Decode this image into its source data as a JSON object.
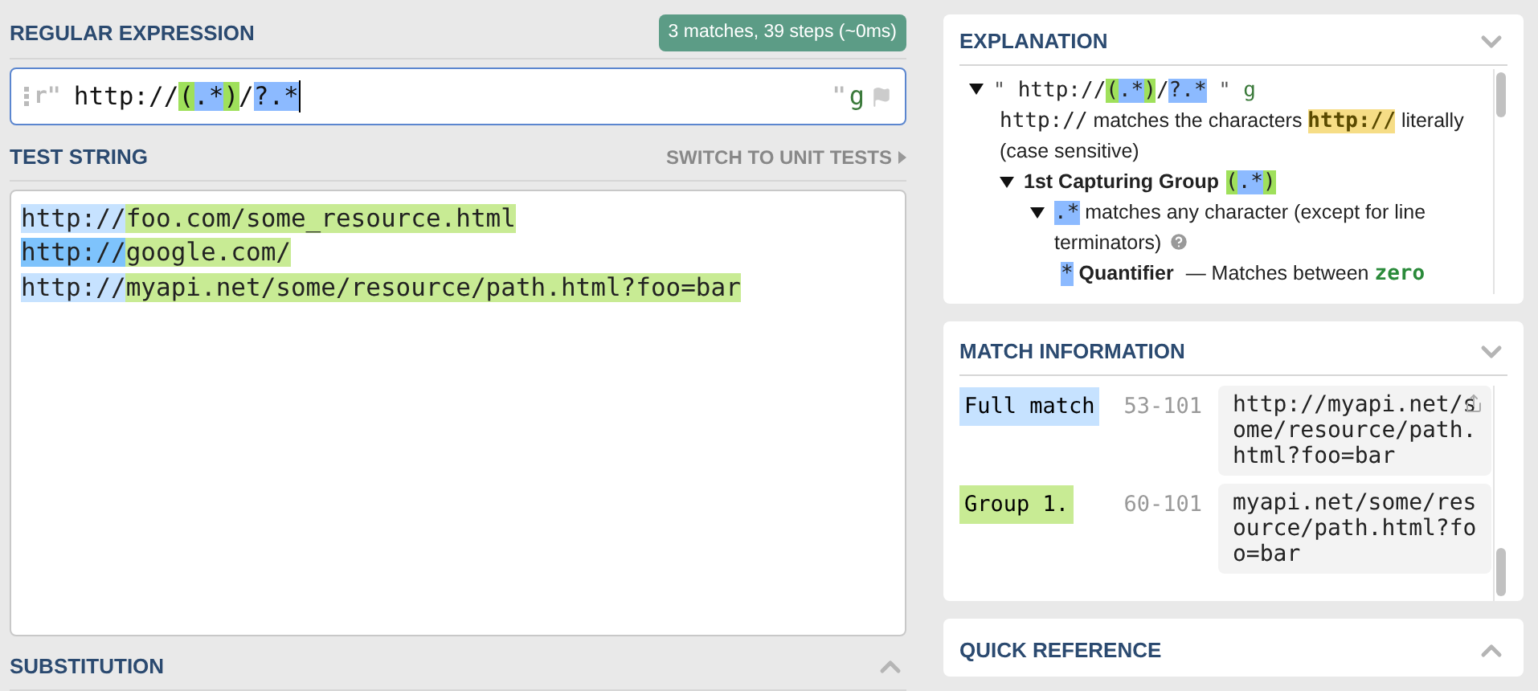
{
  "regex_panel": {
    "title": "REGULAR EXPRESSION",
    "badge": "3 matches, 39 steps (~0ms)",
    "prefix": "r\"",
    "suffix": "\"",
    "flags": "g",
    "segments": [
      {
        "text": "http://",
        "kind": "plain"
      },
      {
        "text": "(",
        "kind": "group"
      },
      {
        "text": ".*",
        "kind": "token"
      },
      {
        "text": ")",
        "kind": "group"
      },
      {
        "text": "/",
        "kind": "plain"
      },
      {
        "text": "?.*",
        "kind": "token"
      }
    ]
  },
  "test_string": {
    "title": "TEST STRING",
    "switch_link": "SWITCH TO UNIT TESTS",
    "lines": [
      {
        "match": "http://",
        "color": "#c6e2ff",
        "group": "foo.com/some_resource.html"
      },
      {
        "match": "http://",
        "color": "#7ec3fc",
        "group": "google.com/"
      },
      {
        "match": "http://",
        "color": "#c6e2ff",
        "group": "myapi.net/some/resource/path.html?foo=bar"
      }
    ]
  },
  "substitution": {
    "title": "SUBSTITUTION",
    "expanded": false
  },
  "explanation": {
    "title": "EXPLANATION",
    "expanded": true,
    "tree": [
      {
        "expanded": true,
        "help": false,
        "parts": [
          {
            "text": "\"",
            "kind": "quote"
          },
          {
            "text": " http://",
            "kind": "mono"
          },
          {
            "text": "(",
            "kind": "group"
          },
          {
            "text": ".*",
            "kind": "token"
          },
          {
            "text": ")",
            "kind": "group"
          },
          {
            "text": "/",
            "kind": "mono"
          },
          {
            "text": "?.*",
            "kind": "token"
          },
          {
            "text": " \"",
            "kind": "quote"
          },
          {
            "text": " g",
            "kind": "flag"
          }
        ],
        "children": [
          {
            "help": false,
            "parts": [
              {
                "text": "http://",
                "kind": "mono"
              },
              {
                "text": " matches the characters ",
                "kind": "plain"
              },
              {
                "text": "http://",
                "kind": "literal"
              },
              {
                "text": " literally (case sensitive)",
                "kind": "plain"
              }
            ]
          },
          {
            "expanded": true,
            "help": false,
            "parts": [
              {
                "text": "1st Capturing Group",
                "kind": "bold"
              },
              {
                "text": "(",
                "kind": "group"
              },
              {
                "text": ".*",
                "kind": "token"
              },
              {
                "text": ")",
                "kind": "group"
              }
            ],
            "children": [
              {
                "expanded": true,
                "help": true,
                "parts": [
                  {
                    "text": ".*",
                    "kind": "token"
                  },
                  {
                    "text": " matches any character (except for line terminators)",
                    "kind": "plain"
                  }
                ],
                "children": [
                  {
                    "help": false,
                    "parts": [
                      {
                        "text": "*",
                        "kind": "token"
                      },
                      {
                        "text": " Quantifier",
                        "kind": "bold"
                      },
                      {
                        "text": " — Matches between ",
                        "kind": "plain"
                      },
                      {
                        "text": "zero",
                        "kind": "zero"
                      }
                    ]
                  }
                ]
              }
            ]
          }
        ]
      }
    ]
  },
  "match_information": {
    "title": "MATCH INFORMATION",
    "expanded": true,
    "rows": [
      {
        "label": "Full match",
        "color": "#c6e2ff",
        "range": "53-101",
        "value": "http://myapi.net/some/resource/path.html?foo=bar",
        "share": true
      },
      {
        "label": "Group 1.",
        "color": "#c8eb94",
        "range": "60-101",
        "value": "myapi.net/some/resource/path.html?foo=bar",
        "share": false
      }
    ]
  },
  "quick_reference": {
    "title": "QUICK REFERENCE",
    "expanded": false
  }
}
